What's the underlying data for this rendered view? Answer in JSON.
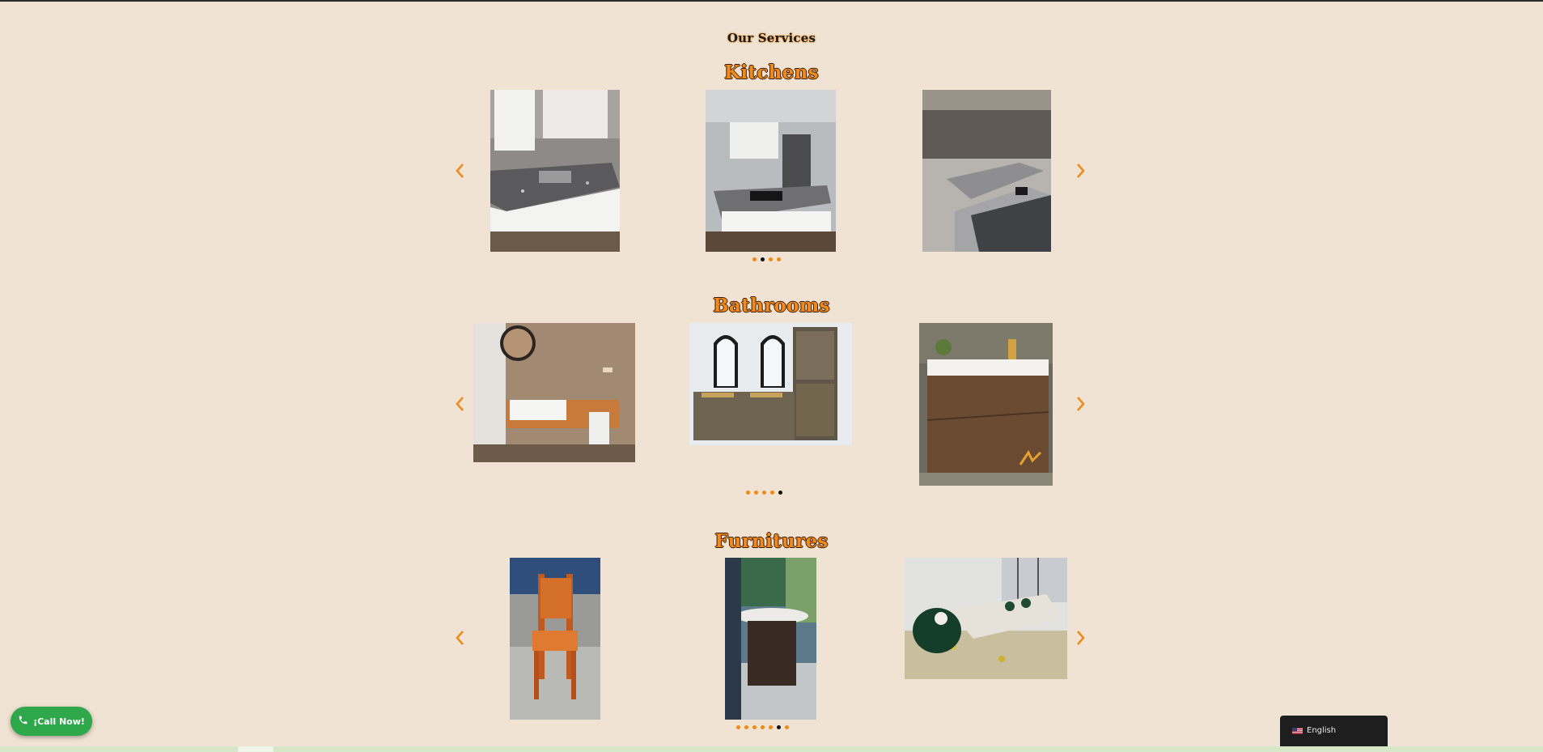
{
  "page": {
    "heading": "Our Services"
  },
  "sections": [
    {
      "title": "Kitchens",
      "dot_count": 4,
      "active_dot": 1
    },
    {
      "title": "Bathrooms",
      "dot_count": 5,
      "active_dot": 4
    },
    {
      "title": "Furnitures",
      "dot_count": 7,
      "active_dot": 5
    }
  ],
  "call_button": {
    "label": "¡Call Now!",
    "icon": "phone-icon",
    "color": "#2ea84b"
  },
  "language_switcher": {
    "label": "English",
    "icon": "us-flag-icon"
  },
  "colors": {
    "background": "#f0e3d3",
    "accent": "#ee8a1a",
    "active_dot": "#111111"
  }
}
